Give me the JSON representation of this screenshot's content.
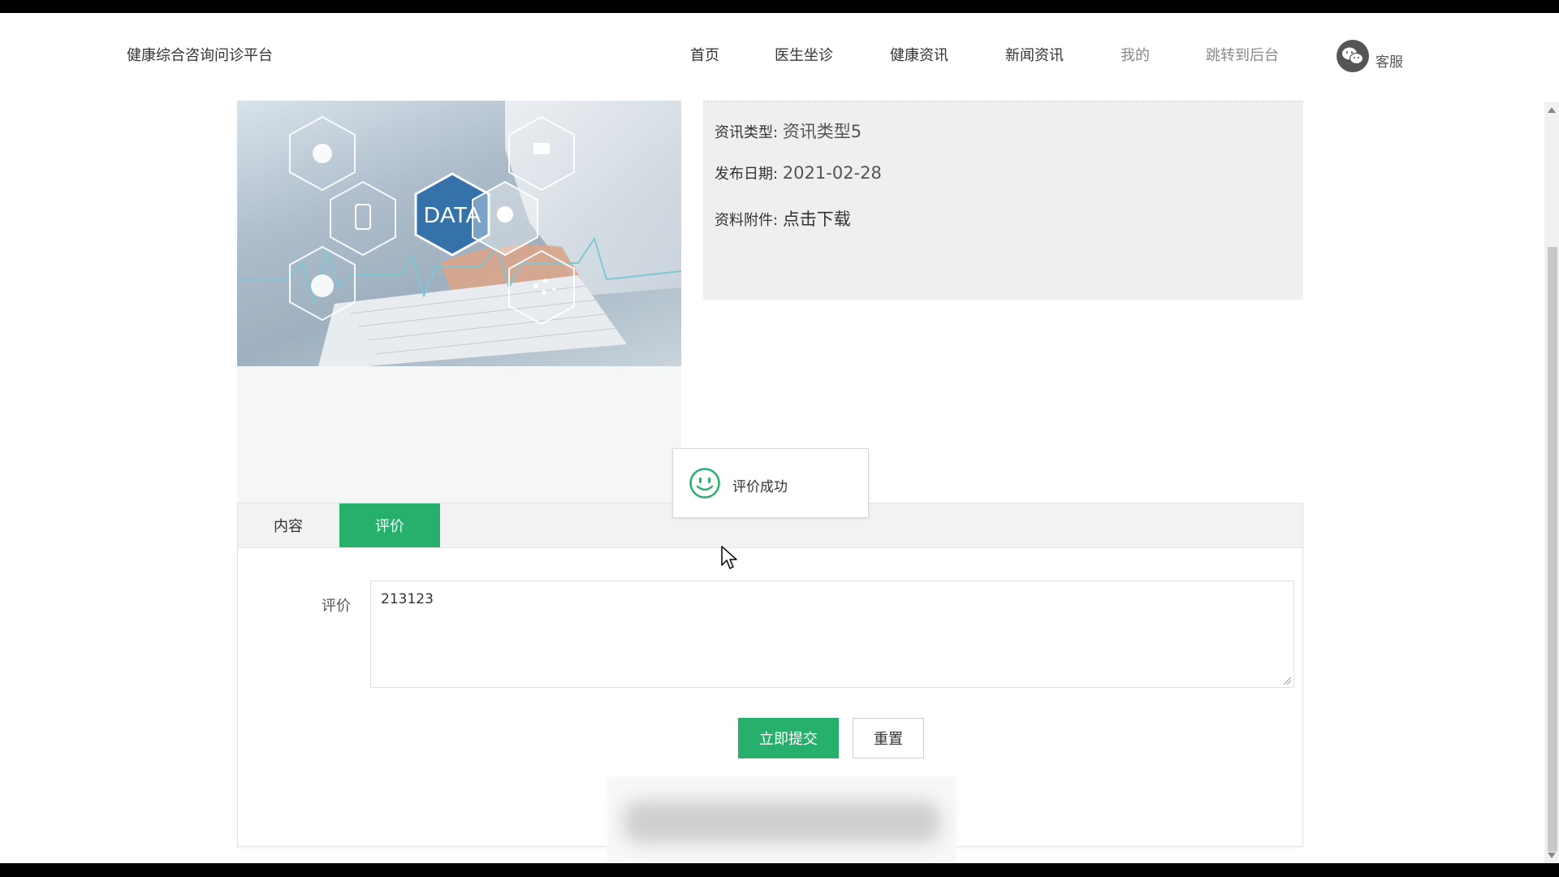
{
  "header": {
    "site_title": "健康综合咨询问诊平台",
    "nav": [
      {
        "label": "首页"
      },
      {
        "label": "医生坐诊"
      },
      {
        "label": "健康资讯"
      },
      {
        "label": "新闻资讯"
      },
      {
        "label": "我的"
      },
      {
        "label": "跳转到后台"
      }
    ],
    "service_label": "客服"
  },
  "hero_image": {
    "badge_text": "DATA"
  },
  "info": {
    "type_label": "资讯类型:",
    "type_value": "资讯类型5",
    "date_label": "发布日期:",
    "date_value": "2021-02-28",
    "attachment_label": "资料附件:",
    "attachment_link": "点击下载"
  },
  "toast": {
    "message": "评价成功"
  },
  "tabs": [
    {
      "label": "内容",
      "active": false
    },
    {
      "label": "评价",
      "active": true
    }
  ],
  "review_form": {
    "label": "评价",
    "value": "213123",
    "submit_label": "立即提交",
    "reset_label": "重置"
  },
  "colors": {
    "accent": "#27b06c",
    "panel_bg": "#efefef",
    "hex_blue": "#2f6fa8"
  },
  "icons": {
    "service": "wechat-icon",
    "toast": "smiley-icon"
  }
}
